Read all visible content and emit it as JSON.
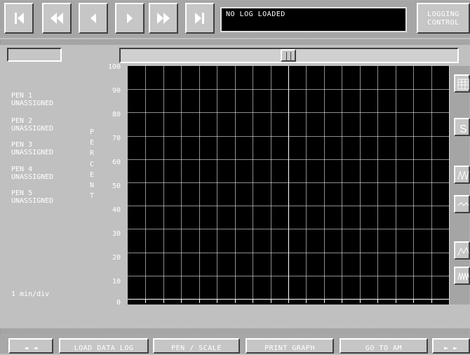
{
  "status": {
    "message": "NO LOG LOADED"
  },
  "logging_control": {
    "line1": "LOGGING",
    "line2": "CONTROL"
  },
  "pens": [
    {
      "name": "PEN 1",
      "status": "UNASSIGNED"
    },
    {
      "name": "PEN 2",
      "status": "UNASSIGNED"
    },
    {
      "name": "PEN 3",
      "status": "UNASSIGNED"
    },
    {
      "name": "PEN 4",
      "status": "UNASSIGNED"
    },
    {
      "name": "PEN 5",
      "status": "UNASSIGNED"
    }
  ],
  "axis": {
    "label": "PERCENT",
    "ticks": [
      "100",
      "90",
      "80",
      "70",
      "60",
      "50",
      "40",
      "30",
      "20",
      "10",
      "0"
    ]
  },
  "time_scale": "1 min/div",
  "bottom": {
    "prev": "◄ ◄",
    "load": "LOAD DATA LOG",
    "pen_scale": "PEN / SCALE",
    "print": "PRINT GRAPH",
    "goto": "GO TO AM",
    "next": "► ►"
  },
  "icons": {
    "first": "skip-to-first-icon",
    "rewind": "rewind-icon",
    "prev": "step-back-icon",
    "play": "play-icon",
    "ffwd": "fast-forward-icon",
    "last": "skip-to-last-icon"
  },
  "colors": {
    "grid_bg": "#000000",
    "grid_line": "#ffffff",
    "panel": "#c0c0c0"
  }
}
